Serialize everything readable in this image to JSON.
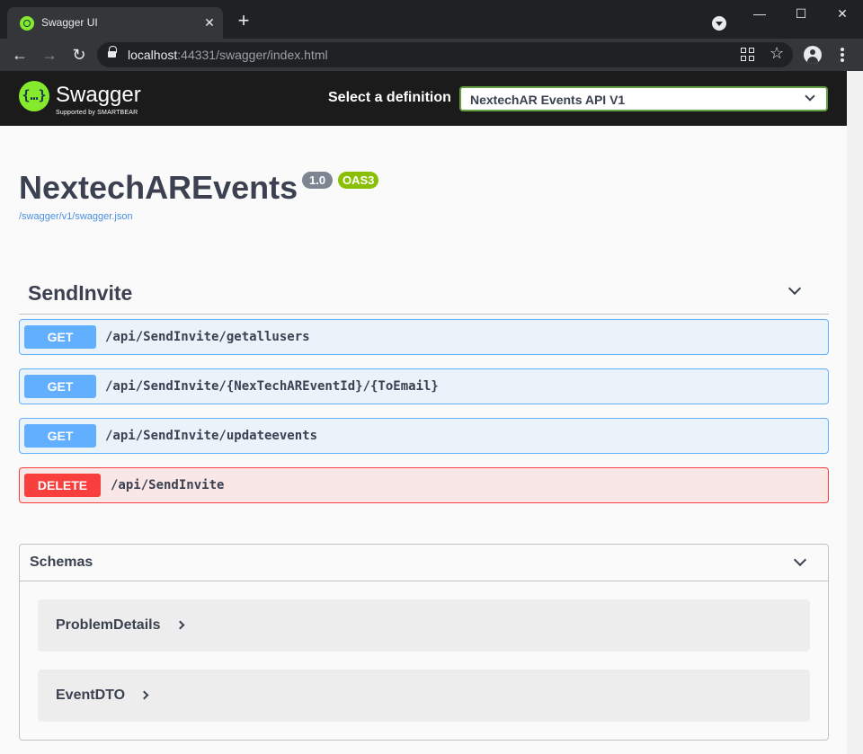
{
  "browser": {
    "tab_title": "Swagger UI",
    "tab_close": "✕",
    "new_tab": "+",
    "url_host": "localhost",
    "url_rest": ":44331/swagger/index.html",
    "window_controls": {
      "minimize": "—",
      "maximize": "☐",
      "close": "✕"
    },
    "nav": {
      "back": "←",
      "forward": "→",
      "reload": "↻"
    },
    "star": "☆"
  },
  "topbar": {
    "logo_mark": "{…}",
    "logo_text": "Swagger",
    "logo_subtext": "Supported by SMARTBEAR",
    "definition_label": "Select a definition",
    "definition_selected": "NextechAR Events API V1"
  },
  "info": {
    "title": "NextechAREvents",
    "version": "1.0",
    "oas_badge": "OAS3",
    "spec_url": "/swagger/v1/swagger.json"
  },
  "tag": {
    "name": "SendInvite",
    "operations": [
      {
        "method": "GET",
        "path": "/api/SendInvite/getallusers"
      },
      {
        "method": "GET",
        "path": "/api/SendInvite/{NexTechAREventId}/{ToEmail}"
      },
      {
        "method": "GET",
        "path": "/api/SendInvite/updateevents"
      },
      {
        "method": "DELETE",
        "path": "/api/SendInvite"
      }
    ]
  },
  "schemas": {
    "title": "Schemas",
    "items": [
      "ProblemDetails",
      "EventDTO"
    ]
  },
  "colors": {
    "get": "#61affe",
    "delete": "#f93e3e",
    "swagger_green": "#85ea2d",
    "oas_badge": "#89bf04",
    "version_badge": "#7d8492"
  }
}
